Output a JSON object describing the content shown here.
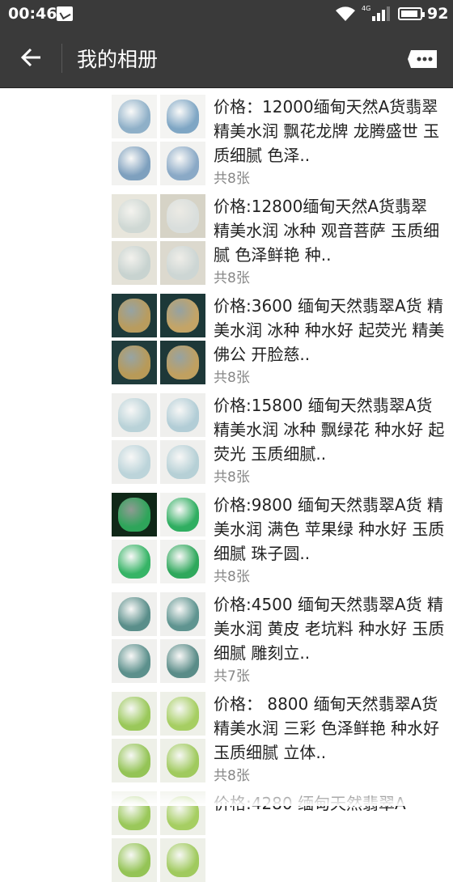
{
  "status": {
    "time": "00:46",
    "network": "4G",
    "battery": "92"
  },
  "header": {
    "title": "我的相册"
  },
  "colors": {
    "bar": "#3a3a3a"
  },
  "albums": [
    {
      "desc": "价格：12000缅甸天然A货翡翠 精美水润 飘花龙牌 龙腾盛世 玉质细腻 色泽..",
      "count": "共8张",
      "thumbs": [
        {
          "bg": "#f4f4f2",
          "gem": "#8fb0c8"
        },
        {
          "bg": "#f4f4f2",
          "gem": "#7fa6c4"
        },
        {
          "bg": "#f2f2f0",
          "gem": "#7ea0be"
        },
        {
          "bg": "#f2f2f0",
          "gem": "#8aa9c6"
        }
      ]
    },
    {
      "desc": "价格:12800缅甸天然A货翡翠 精美水润 冰种 观音菩萨 玉质细腻 色泽鲜艳 种..",
      "count": "共8张",
      "thumbs": [
        {
          "bg": "#e8e6dc",
          "gem": "#cfd8d4"
        },
        {
          "bg": "#d6d3c6",
          "gem": "#d9dedc"
        },
        {
          "bg": "#e4e2d8",
          "gem": "#c8d3d0"
        },
        {
          "bg": "#dcd9ce",
          "gem": "#cdd6d4"
        }
      ]
    },
    {
      "desc": "价格:3600 缅甸天然翡翠A货 精美水润 冰种 种水好 起荧光 精美佛公 开脸慈..",
      "count": "共8张",
      "thumbs": [
        {
          "bg": "#1e3a3a",
          "gem": "#b99c5e"
        },
        {
          "bg": "#1c3838",
          "gem": "#c4a466"
        },
        {
          "bg": "#203c3c",
          "gem": "#b89a58"
        },
        {
          "bg": "#1e3838",
          "gem": "#c0a060"
        }
      ]
    },
    {
      "desc": "价格:15800 缅甸天然翡翠A货 精美水润 冰种 飘绿花 种水好 起荧光 玉质细腻..",
      "count": "共8张",
      "thumbs": [
        {
          "bg": "#efefed",
          "gem": "#b9d2d8"
        },
        {
          "bg": "#efefed",
          "gem": "#b2cdd6"
        },
        {
          "bg": "#efefed",
          "gem": "#bcd4da"
        },
        {
          "bg": "#efefed",
          "gem": "#b6d0d6"
        }
      ]
    },
    {
      "desc": "价格:9800 缅甸天然翡翠A货 精美水润 满色 苹果绿 种水好 玉质细腻 珠子圆..",
      "count": "共8张",
      "thumbs": [
        {
          "bg": "#102818",
          "gem": "#2ea55a"
        },
        {
          "bg": "#f2f2f0",
          "gem": "#2fae61"
        },
        {
          "bg": "#f2f2f0",
          "gem": "#36b466"
        },
        {
          "bg": "#f2f2f0",
          "gem": "#2fa85c"
        }
      ]
    },
    {
      "desc": "价格:4500 缅甸天然翡翠A货 精美水润 黄皮 老坑料 种水好 玉质细腻 雕刻立..",
      "count": "共7张",
      "thumbs": [
        {
          "bg": "#f0f0ee",
          "gem": "#5a8e8a"
        },
        {
          "bg": "#f0f0ee",
          "gem": "#5f9490"
        },
        {
          "bg": "#f0f0ee",
          "gem": "#5c908c"
        },
        {
          "bg": "#f0f0ee",
          "gem": "#5a8c88"
        }
      ]
    },
    {
      "desc": "价格： 8800 缅甸天然翡翠A货 精美水润 三彩 色泽鲜艳 种水好 玉质细腻 立体..",
      "count": "共8张",
      "thumbs": [
        {
          "bg": "#eef0e8",
          "gem": "#9ac85a"
        },
        {
          "bg": "#eef0e8",
          "gem": "#a6ce62"
        },
        {
          "bg": "#eef0e8",
          "gem": "#94c456"
        },
        {
          "bg": "#eef0e8",
          "gem": "#a0ca5e"
        }
      ]
    },
    {
      "desc": "价格:4280 缅甸天然翡翠A",
      "count": "",
      "thumbs": [
        {
          "bg": "#eef0e8",
          "gem": "#9ac85a"
        },
        {
          "bg": "#eef0e8",
          "gem": "#a6ce62"
        },
        {
          "bg": "#eef0e8",
          "gem": "#94c456"
        },
        {
          "bg": "#eef0e8",
          "gem": "#a0ca5e"
        }
      ]
    }
  ]
}
